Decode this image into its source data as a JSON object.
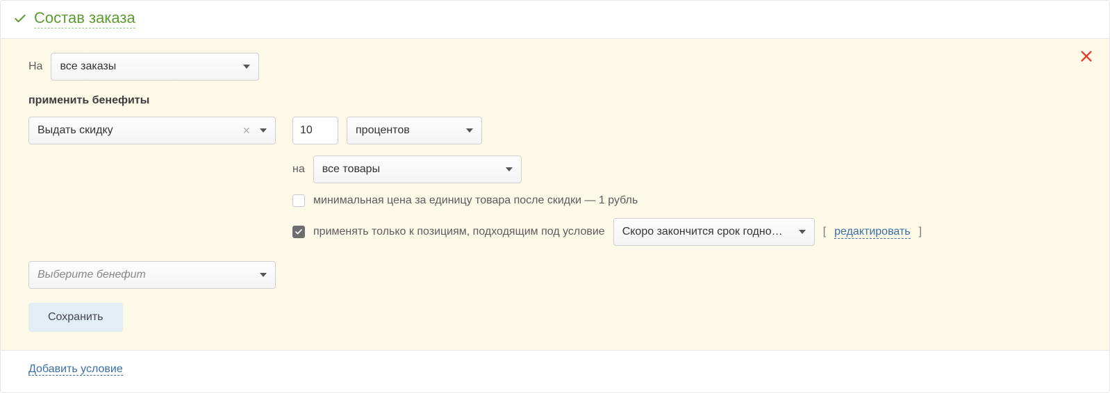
{
  "header": {
    "title": "Состав заказа"
  },
  "scope": {
    "label": "На",
    "select_value": "все заказы"
  },
  "benefits": {
    "heading": "применить бенефиты",
    "type_value": "Выдать скидку",
    "amount": "10",
    "unit_value": "процентов",
    "target_label": "на",
    "target_value": "все товары",
    "min_price": {
      "checked": false,
      "label": "минимальная цена за единицу товара после скидки — 1 рубль"
    },
    "apply_condition": {
      "checked": true,
      "label": "применять только к позициям, подходящим под условие",
      "condition_value": "Скоро закончится срок годно…",
      "edit_label": "редактировать"
    },
    "add_placeholder": "Выберите бенефит"
  },
  "actions": {
    "save": "Сохранить",
    "add_condition": "Добавить условие"
  }
}
